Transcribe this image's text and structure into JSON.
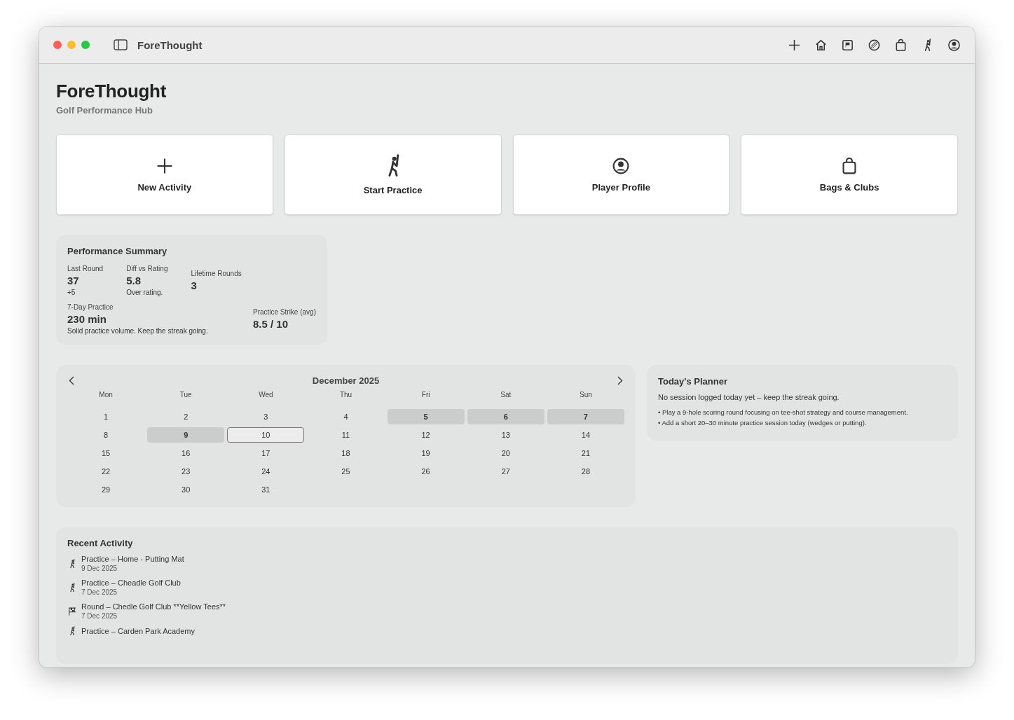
{
  "window": {
    "title": "ForeThought"
  },
  "toolbar": [
    {
      "kind": "plus"
    },
    {
      "kind": "home"
    },
    {
      "kind": "flag"
    },
    {
      "kind": "ball"
    },
    {
      "kind": "bag"
    },
    {
      "kind": "golfer"
    },
    {
      "kind": "profile"
    }
  ],
  "header": {
    "title": "ForeThought",
    "subtitle": "Golf Performance Hub"
  },
  "actions": [
    {
      "kind": "plus",
      "label": "New Activity"
    },
    {
      "kind": "golfer",
      "label": "Start Practice"
    },
    {
      "kind": "profile",
      "label": "Player Profile"
    },
    {
      "kind": "bag",
      "label": "Bags & Clubs"
    }
  ],
  "summary": {
    "title": "Performance Summary",
    "top": [
      {
        "label": "Last Round",
        "value": "37",
        "note": "+5"
      },
      {
        "label": "Diff vs Rating",
        "value": "5.8",
        "note": "Over rating."
      },
      {
        "label": "Lifetime Rounds",
        "value": "3"
      }
    ],
    "bottom": [
      {
        "label": "7-Day Practice",
        "value": "230 min",
        "note": "Solid practice volume. Keep the streak going."
      },
      {
        "label": "Practice Strike (avg)",
        "value": "8.5 / 10"
      }
    ]
  },
  "calendar": {
    "month": "December 2025",
    "weekdays": [
      "Mon",
      "Tue",
      "Wed",
      "Thu",
      "Fri",
      "Sat",
      "Sun"
    ],
    "days": [
      {
        "label": "1",
        "selected": false,
        "today": false
      },
      {
        "label": "2",
        "selected": false,
        "today": false
      },
      {
        "label": "3",
        "selected": false,
        "today": false
      },
      {
        "label": "4",
        "selected": false,
        "today": false
      },
      {
        "label": "5",
        "selected": true,
        "today": false
      },
      {
        "label": "6",
        "selected": true,
        "today": false
      },
      {
        "label": "7",
        "selected": true,
        "today": false
      },
      {
        "label": "8",
        "selected": false,
        "today": false
      },
      {
        "label": "9",
        "selected": true,
        "today": false
      },
      {
        "label": "10",
        "selected": false,
        "today": true
      },
      {
        "label": "11",
        "selected": false,
        "today": false
      },
      {
        "label": "12",
        "selected": false,
        "today": false
      },
      {
        "label": "13",
        "selected": false,
        "today": false
      },
      {
        "label": "14",
        "selected": false,
        "today": false
      },
      {
        "label": "15",
        "selected": false,
        "today": false
      },
      {
        "label": "16",
        "selected": false,
        "today": false
      },
      {
        "label": "17",
        "selected": false,
        "today": false
      },
      {
        "label": "18",
        "selected": false,
        "today": false
      },
      {
        "label": "19",
        "selected": false,
        "today": false
      },
      {
        "label": "20",
        "selected": false,
        "today": false
      },
      {
        "label": "21",
        "selected": false,
        "today": false
      },
      {
        "label": "22",
        "selected": false,
        "today": false
      },
      {
        "label": "23",
        "selected": false,
        "today": false
      },
      {
        "label": "24",
        "selected": false,
        "today": false
      },
      {
        "label": "25",
        "selected": false,
        "today": false
      },
      {
        "label": "26",
        "selected": false,
        "today": false
      },
      {
        "label": "27",
        "selected": false,
        "today": false
      },
      {
        "label": "28",
        "selected": false,
        "today": false
      },
      {
        "label": "29",
        "selected": false,
        "today": false
      },
      {
        "label": "30",
        "selected": false,
        "today": false
      },
      {
        "label": "31",
        "selected": false,
        "today": false
      }
    ]
  },
  "planner": {
    "title": "Today's Planner",
    "status": "No session logged today yet – keep the streak going.",
    "tips": [
      "• Play a 9-hole scoring round focusing on tee-shot strategy and course management.",
      "• Add a short 20–30 minute practice session today (wedges or putting)."
    ]
  },
  "recent": {
    "title": "Recent Activity",
    "items": [
      {
        "kind": "practice",
        "title": "Practice – Home - Putting Mat",
        "date": "9 Dec 2025"
      },
      {
        "kind": "practice",
        "title": "Practice – Cheadle Golf Club",
        "date": "7 Dec 2025"
      },
      {
        "kind": "round",
        "title": "Round – Chedle Golf Club **Yellow Tees**",
        "date": "7 Dec 2025"
      },
      {
        "kind": "practice",
        "title": "Practice – Carden Park Academy"
      }
    ]
  }
}
